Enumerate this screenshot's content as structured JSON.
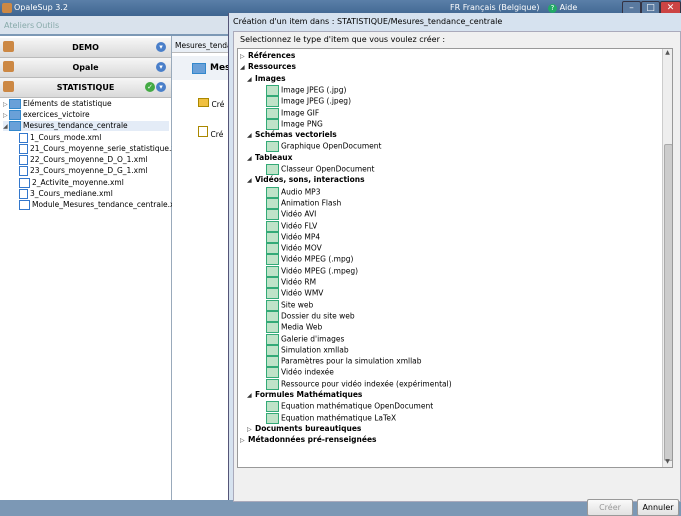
{
  "app": {
    "title": "OpaleSup 3.2",
    "lang": "FR Français (Belgique)",
    "help": "Aide"
  },
  "menubar": {
    "items": [
      "Ateliers",
      "Outils"
    ]
  },
  "workshops": [
    {
      "label": "DEMO"
    },
    {
      "label": "Opale"
    },
    {
      "label": "STATISTIQUE"
    }
  ],
  "tree": [
    {
      "label": "Eléments de statistique",
      "type": "folder",
      "level": 0
    },
    {
      "label": "exercices_victoire",
      "type": "folder",
      "level": 0
    },
    {
      "label": "Mesures_tendance_centrale",
      "type": "folder-open",
      "level": 0
    },
    {
      "label": "1_Cours_mode.xml",
      "type": "file",
      "level": 1
    },
    {
      "label": "21_Cours_moyenne_serie_statistique.xml",
      "type": "file",
      "level": 1
    },
    {
      "label": "22_Cours_moyenne_D_O_1.xml",
      "type": "file",
      "level": 1
    },
    {
      "label": "23_Cours_moyenne_D_G_1.xml",
      "type": "file",
      "level": 1
    },
    {
      "label": "2_Activite_moyenne.xml",
      "type": "file",
      "level": 1
    },
    {
      "label": "3_Cours_mediane.xml",
      "type": "file",
      "level": 1
    },
    {
      "label": "Module_Mesures_tendance_centrale.xml",
      "type": "file",
      "level": 1
    }
  ],
  "middle": {
    "tab": "Mesures_tenda",
    "title": "Mes",
    "actions": [
      "Cré",
      "Cré"
    ]
  },
  "dialog": {
    "title": "Création d'un item dans : STATISTIQUE/Mesures_tendance_centrale",
    "prompt": "Selectionnez le type d'item que vous voulez créer :",
    "items": [
      {
        "label": "Références",
        "level": 0,
        "bold": true,
        "arrow": "▷"
      },
      {
        "label": "Ressources",
        "level": 0,
        "bold": true,
        "arrow": "◢"
      },
      {
        "label": "Images",
        "level": 1,
        "bold": true,
        "arrow": "◢"
      },
      {
        "label": "Image JPEG (.jpg)",
        "level": 2,
        "icon": true
      },
      {
        "label": "Image JPEG (.jpeg)",
        "level": 2,
        "icon": true
      },
      {
        "label": "Image GIF",
        "level": 2,
        "icon": true
      },
      {
        "label": "Image PNG",
        "level": 2,
        "icon": true
      },
      {
        "label": "Schémas vectoriels",
        "level": 1,
        "bold": true,
        "arrow": "◢"
      },
      {
        "label": "Graphique OpenDocument",
        "level": 2,
        "icon": true
      },
      {
        "label": "Tableaux",
        "level": 1,
        "bold": true,
        "arrow": "◢"
      },
      {
        "label": "Classeur OpenDocument",
        "level": 2,
        "icon": true
      },
      {
        "label": "Vidéos, sons, interactions",
        "level": 1,
        "bold": true,
        "arrow": "◢"
      },
      {
        "label": "Audio MP3",
        "level": 2,
        "icon": true
      },
      {
        "label": "Animation Flash",
        "level": 2,
        "icon": true
      },
      {
        "label": "Vidéo AVI",
        "level": 2,
        "icon": true
      },
      {
        "label": "Vidéo FLV",
        "level": 2,
        "icon": true
      },
      {
        "label": "Vidéo MP4",
        "level": 2,
        "icon": true
      },
      {
        "label": "Vidéo MOV",
        "level": 2,
        "icon": true
      },
      {
        "label": "Vidéo MPEG (.mpg)",
        "level": 2,
        "icon": true
      },
      {
        "label": "Vidéo MPEG (.mpeg)",
        "level": 2,
        "icon": true
      },
      {
        "label": "Vidéo RM",
        "level": 2,
        "icon": true
      },
      {
        "label": "Vidéo WMV",
        "level": 2,
        "icon": true
      },
      {
        "label": "Site web",
        "level": 2,
        "icon": true
      },
      {
        "label": "Dossier du site web",
        "level": 2,
        "icon": true
      },
      {
        "label": "Media Web",
        "level": 2,
        "icon": true
      },
      {
        "label": "Galerie d'images",
        "level": 2,
        "icon": true
      },
      {
        "label": "Simulation xmllab",
        "level": 2,
        "icon": true
      },
      {
        "label": "Paramètres pour la simulation xmllab",
        "level": 2,
        "icon": true
      },
      {
        "label": "Vidéo indexée",
        "level": 2,
        "icon": true
      },
      {
        "label": "Ressource pour vidéo indexée (expérimental)",
        "level": 2,
        "icon": true
      },
      {
        "label": "Formules Mathématiques",
        "level": 1,
        "bold": true,
        "arrow": "◢"
      },
      {
        "label": "Equation mathématique OpenDocument",
        "level": 2,
        "icon": true
      },
      {
        "label": "Equation mathématique LaTeX",
        "level": 2,
        "icon": true
      },
      {
        "label": "Documents bureautiques",
        "level": 1,
        "bold": true,
        "arrow": "▷"
      },
      {
        "label": "Métadonnées pré-renseignées",
        "level": 0,
        "bold": true,
        "arrow": "▷"
      }
    ],
    "buttons": {
      "create": "Créer",
      "cancel": "Annuler"
    }
  }
}
